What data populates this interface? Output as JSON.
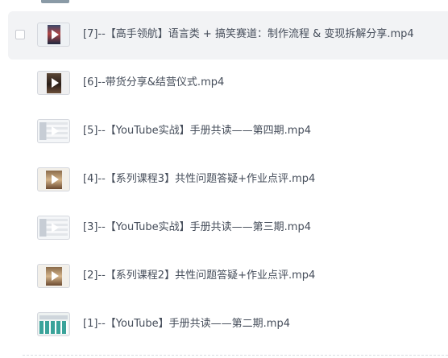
{
  "files": [
    {
      "name": "[7]--【高手领航】语言类 + 搞笑赛道：制作流程 & 变现拆解分享.mp4",
      "thumbnail": "portrait-video",
      "hovered": true
    },
    {
      "name": "[6]--带货分享&结营仪式.mp4",
      "thumbnail": "dark-video",
      "hovered": false
    },
    {
      "name": "[5]--【YouTube实战】手册共读——第四期.mp4",
      "thumbnail": "screen-recording",
      "hovered": false
    },
    {
      "name": "[4]--【系列课程3】共性问题答疑+作业点评.mp4",
      "thumbnail": "mixed-video",
      "hovered": false
    },
    {
      "name": "[3]--【YouTube实战】手册共读——第三期.mp4",
      "thumbnail": "screen-recording",
      "hovered": false
    },
    {
      "name": "[2]--【系列课程2】共性问题答疑+作业点评.mp4",
      "thumbnail": "mixed-video",
      "hovered": false
    },
    {
      "name": "[1]--【YouTube】手册共读——第二期.mp4",
      "thumbnail": "grid-screenshot",
      "hovered": false
    }
  ],
  "icons": {
    "checkbox": "checkbox-icon",
    "play": "play-icon"
  },
  "colors": {
    "hover_background": "#f2f3f5",
    "text": "#454d5a"
  }
}
